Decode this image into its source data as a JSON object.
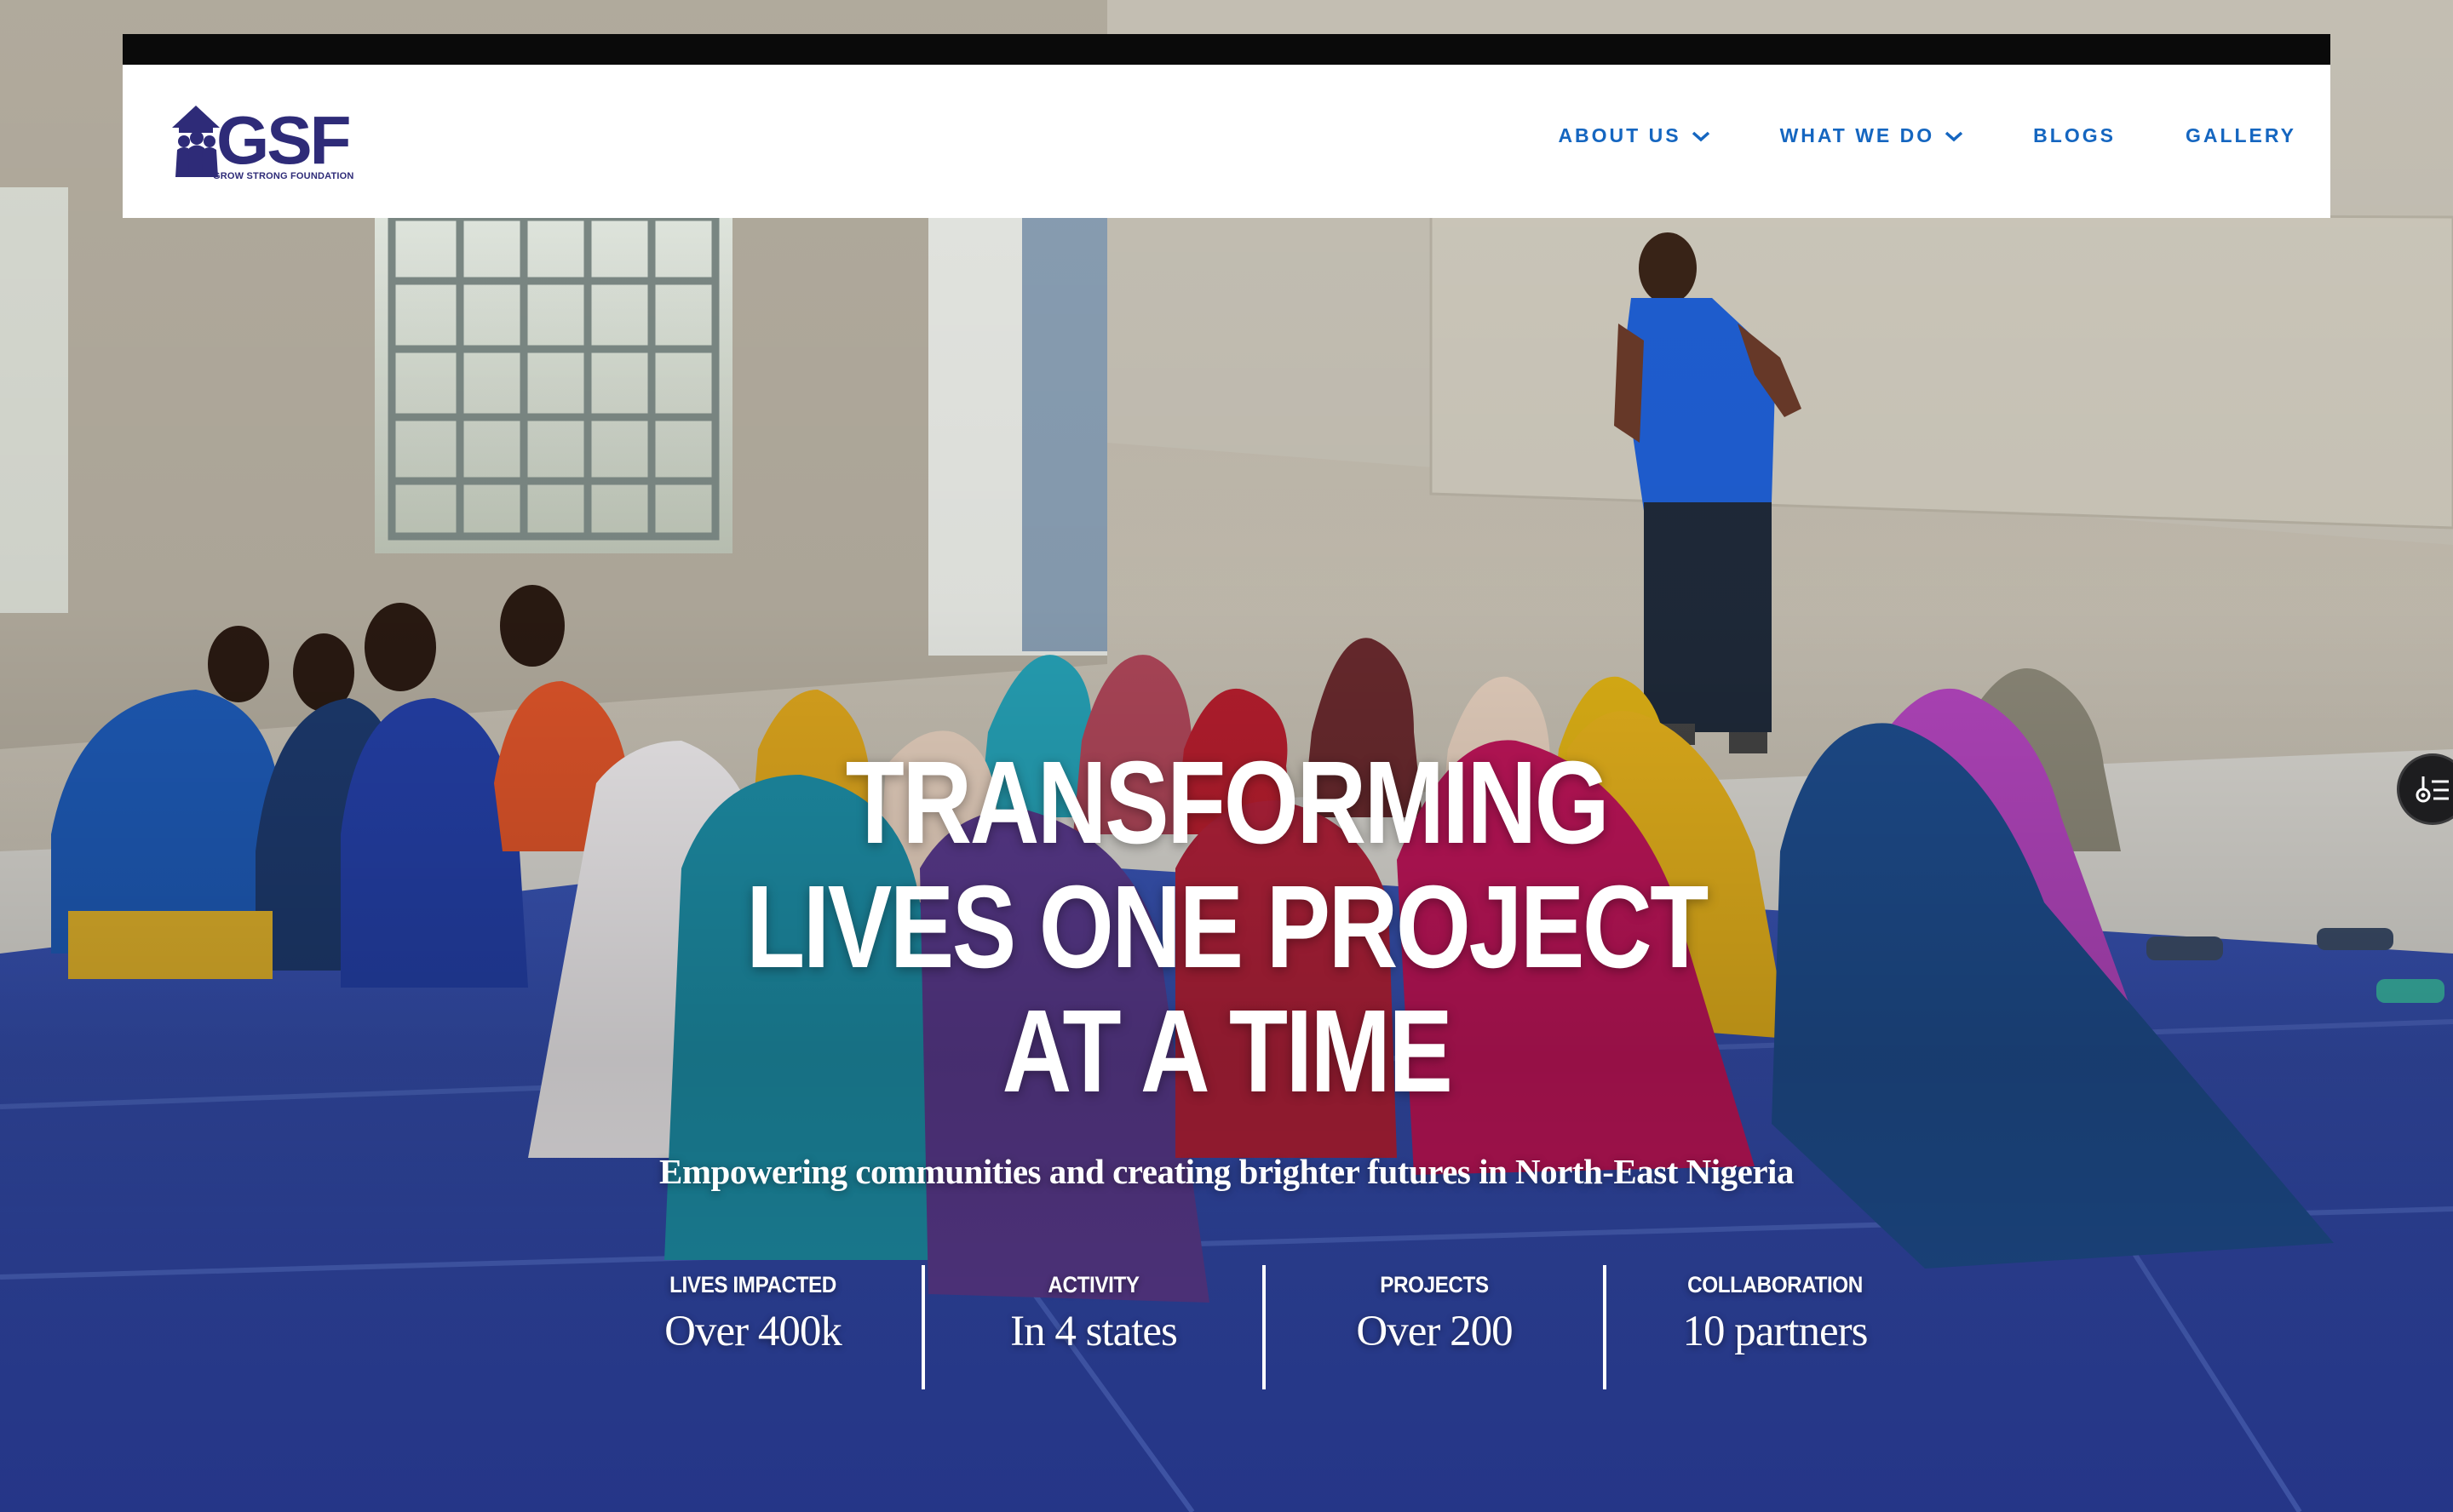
{
  "brand": {
    "name": "GSF",
    "tagline": "GROW STRONG FOUNDATION",
    "color": "#2e2b78"
  },
  "nav": {
    "accent": "#1566c0",
    "items": [
      {
        "label": "ABOUT US",
        "has_dropdown": true
      },
      {
        "label": "WHAT WE DO",
        "has_dropdown": true
      },
      {
        "label": "BLOGS",
        "has_dropdown": false
      },
      {
        "label": "GALLERY",
        "has_dropdown": false
      }
    ]
  },
  "hero": {
    "headline": [
      "TRANSFORMING",
      "LIVES ONE PROJECT",
      "AT A TIME"
    ],
    "subtitle": "Empowering communities and creating brighter futures in North-East Nigeria"
  },
  "stats": [
    {
      "label": "LIVES IMPACTED",
      "value": "Over 400k"
    },
    {
      "label": "ACTIVITY",
      "value": "In 4 states"
    },
    {
      "label": "PROJECTS",
      "value": "Over 200"
    },
    {
      "label": "COLLABORATION",
      "value": "10 partners"
    }
  ],
  "floating_button": {
    "icon": "settings-list-icon"
  }
}
